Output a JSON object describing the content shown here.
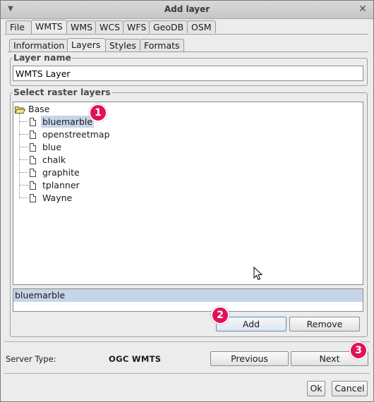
{
  "window": {
    "title": "Add layer"
  },
  "main_tabs": [
    "File",
    "WMTS",
    "WMS",
    "WCS",
    "WFS",
    "GeoDB",
    "OSM"
  ],
  "sub_tabs": [
    "Information",
    "Layers",
    "Styles",
    "Formats"
  ],
  "layer_name": {
    "title": "Layer name",
    "value": "WMTS Layer"
  },
  "raster": {
    "title": "Select raster layers",
    "root": "Base",
    "items": [
      "bluemarble",
      "openstreetmap",
      "blue",
      "chalk",
      "graphite",
      "tplanner",
      "Wayne"
    ],
    "selected_list": [
      "bluemarble"
    ]
  },
  "buttons": {
    "add": "Add",
    "remove": "Remove",
    "previous": "Previous",
    "next": "Next",
    "ok": "Ok",
    "cancel": "Cancel"
  },
  "server": {
    "label": "Server Type:",
    "value": "OGC WMTS"
  },
  "badges": [
    "1",
    "2",
    "3"
  ]
}
